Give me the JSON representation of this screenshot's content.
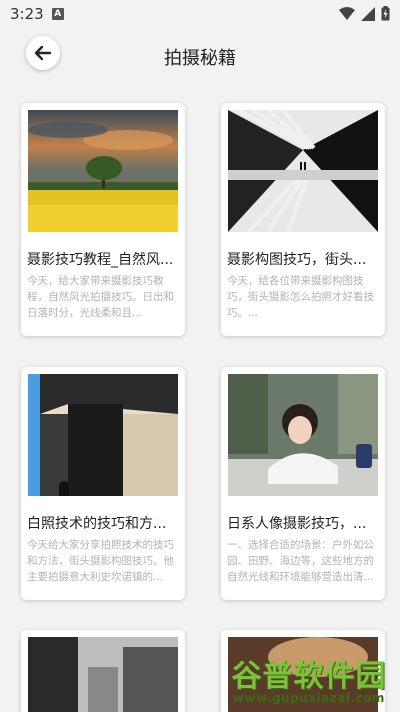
{
  "status_bar": {
    "time": "3:23",
    "a_label": "A"
  },
  "header": {
    "title": "拍摄秘籍"
  },
  "cards": [
    {
      "title": "聂影技巧教程_自然风...",
      "desc": "今天，给大家带来摄影技巧教程，自然风光拍摄技巧。日出和日落时分，光线柔和且..."
    },
    {
      "title": "聂影构图技巧，街头...",
      "desc": "今天，给各位带来摄影构图技巧，街头摄影怎么拍照才好看技巧。..."
    },
    {
      "title": "白照技术的技巧和方...",
      "desc": "今天给大家分享拍照技术的技巧和方法，街头摄影构图技巧。他主要拍摄意大利史坎诺镇的..."
    },
    {
      "title": "日系人像摄影技巧，...",
      "desc": "一、选择合适的场景：户外如公园、田野、海边等，这些地方的自然光线和环境能够营造出清..."
    }
  ],
  "watermark": {
    "title": "谷普软件园",
    "url": "www.gupuxiazai.com"
  }
}
